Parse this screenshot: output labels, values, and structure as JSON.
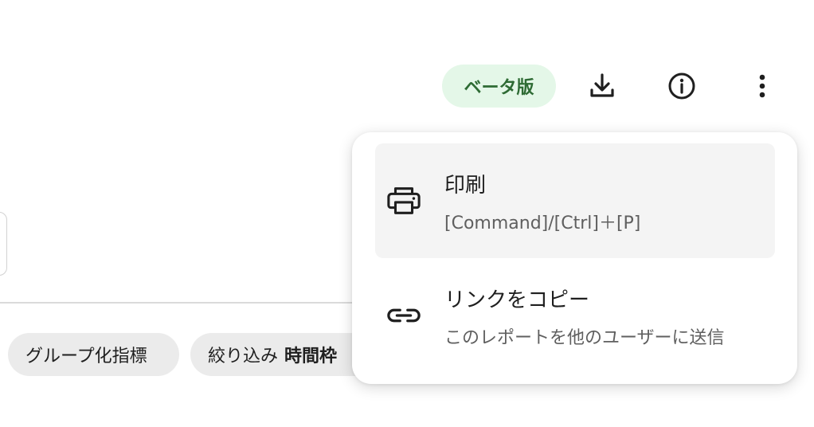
{
  "header": {
    "beta_badge": "ベータ版",
    "download_icon": "download-icon",
    "info_icon": "info-icon",
    "more_icon": "more-vertical-icon"
  },
  "chips": {
    "grouping": "グループ化指標",
    "filter_label": "絞り込み",
    "filter_value": "時間枠"
  },
  "menu": {
    "items": [
      {
        "icon": "printer-icon",
        "title": "印刷",
        "subtitle": "[Command]/[Ctrl]＋[P]"
      },
      {
        "icon": "link-icon",
        "title": "リンクをコピー",
        "subtitle": "このレポートを他のユーザーに送信"
      }
    ]
  },
  "colors": {
    "beta_badge_bg": "#e4f7e8",
    "beta_badge_text": "#2e6b34",
    "menu_hover_bg": "#f4f4f4",
    "chip_bg": "#ebebeb"
  }
}
